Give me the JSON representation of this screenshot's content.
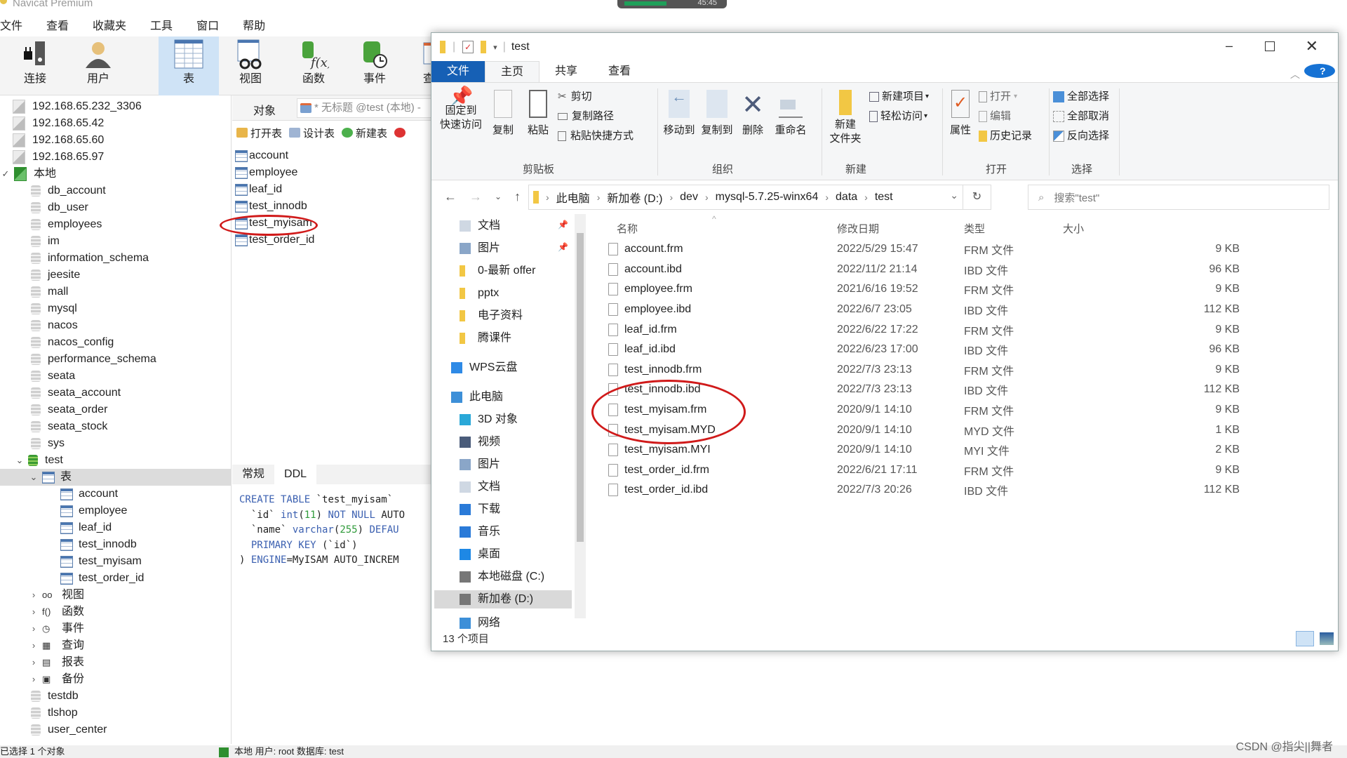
{
  "navicat": {
    "title": "Navicat Premium",
    "recording_time": "45:45",
    "menu": [
      "文件",
      "查看",
      "收藏夹",
      "工具",
      "窗口",
      "帮助"
    ],
    "toolbar": [
      {
        "label": "连接",
        "icon": "plug-server-icon"
      },
      {
        "label": "用户",
        "icon": "user-icon"
      },
      {
        "label": "表",
        "icon": "table-icon",
        "active": true
      },
      {
        "label": "视图",
        "icon": "view-glasses-icon"
      },
      {
        "label": "函数",
        "icon": "function-icon"
      },
      {
        "label": "事件",
        "icon": "event-clock-icon"
      },
      {
        "label": "查",
        "icon": "query-icon"
      }
    ],
    "tree": {
      "connections": [
        "192.168.65.232_3306",
        "192.168.65.42",
        "192.168.65.60",
        "192.168.65.97"
      ],
      "local_label": "本地",
      "databases_before": [
        "db_account",
        "db_user",
        "employees",
        "im",
        "information_schema",
        "jeesite",
        "mall",
        "mysql",
        "nacos",
        "nacos_config",
        "performance_schema",
        "seata",
        "seata_account",
        "seata_order",
        "seata_stock",
        "sys"
      ],
      "open_db": "test",
      "tables_node": "表",
      "tables": [
        "account",
        "employee",
        "leaf_id",
        "test_innodb",
        "test_myisam",
        "test_order_id"
      ],
      "other_nodes": [
        "视图",
        "函数",
        "事件",
        "查询",
        "报表",
        "备份"
      ],
      "databases_after": [
        "testdb",
        "tlshop",
        "user_center"
      ]
    },
    "object_tab": "对象",
    "query_tab": "* 无标题 @test (本地) -",
    "object_tools": [
      "打开表",
      "设计表",
      "新建表"
    ],
    "object_list": [
      "account",
      "employee",
      "leaf_id",
      "test_innodb",
      "test_myisam",
      "test_order_id"
    ],
    "highlighted_object": "test_myisam",
    "info_tabs": [
      "常规",
      "DDL"
    ],
    "ddl_lines": [
      "CREATE TABLE `test_myisam`",
      "  `id` int(11) NOT NULL AUTO",
      "  `name` varchar(255) DEFAU",
      "  PRIMARY KEY (`id`)",
      ") ENGINE=MyISAM AUTO_INCREM"
    ],
    "status_left": "已选择 1 个对象",
    "status_conn": "本地   用户: root   数据库: test"
  },
  "explorer": {
    "title": "test",
    "tabs": [
      "文件",
      "主页",
      "共享",
      "查看"
    ],
    "ribbon": {
      "clipboard": {
        "group": "剪贴板",
        "pin": "固定到\n快速访问",
        "copy": "复制",
        "paste": "粘贴",
        "cut": "剪切",
        "copy_path": "复制路径",
        "paste_shortcut": "粘贴快捷方式"
      },
      "organize": {
        "group": "组织",
        "move_to": "移动到",
        "copy_to": "复制到",
        "delete": "删除",
        "rename": "重命名"
      },
      "new": {
        "group": "新建",
        "new_folder": "新建\n文件夹",
        "new_item": "新建项目",
        "easy_access": "轻松访问"
      },
      "open": {
        "group": "打开",
        "properties": "属性",
        "open": "打开",
        "edit": "编辑",
        "history": "历史记录"
      },
      "select": {
        "group": "选择",
        "select_all": "全部选择",
        "select_none": "全部取消",
        "invert": "反向选择"
      }
    },
    "breadcrumb": [
      "此电脑",
      "新加卷 (D:)",
      "dev",
      "mysql-5.7.25-winx64",
      "data",
      "test"
    ],
    "search_placeholder": "搜索\"test\"",
    "nav_pane": [
      {
        "label": "文档",
        "icon": "document-icon",
        "pinned": true
      },
      {
        "label": "图片",
        "icon": "picture-icon",
        "pinned": true
      },
      {
        "label": "0-最新 offer",
        "icon": "folder-icon"
      },
      {
        "label": "pptx",
        "icon": "folder-icon"
      },
      {
        "label": "电子资料",
        "icon": "folder-icon"
      },
      {
        "label": "腾课件",
        "icon": "folder-icon"
      },
      {
        "label": "WPS云盘",
        "icon": "cloud-icon"
      },
      {
        "label": "此电脑",
        "icon": "computer-icon"
      },
      {
        "label": "3D 对象",
        "icon": "cube-icon"
      },
      {
        "label": "视频",
        "icon": "video-icon"
      },
      {
        "label": "图片",
        "icon": "picture-icon"
      },
      {
        "label": "文档",
        "icon": "document-icon"
      },
      {
        "label": "下载",
        "icon": "download-icon"
      },
      {
        "label": "音乐",
        "icon": "music-icon"
      },
      {
        "label": "桌面",
        "icon": "desktop-icon"
      },
      {
        "label": "本地磁盘 (C:)",
        "icon": "drive-icon"
      },
      {
        "label": "新加卷 (D:)",
        "icon": "drive-icon",
        "selected": true
      },
      {
        "label": "网络",
        "icon": "network-icon"
      }
    ],
    "columns": [
      "名称",
      "修改日期",
      "类型",
      "大小"
    ],
    "files": [
      {
        "name": "account.frm",
        "date": "2022/5/29 15:47",
        "type": "FRM 文件",
        "size": "9 KB"
      },
      {
        "name": "account.ibd",
        "date": "2022/11/2 21:14",
        "type": "IBD 文件",
        "size": "96 KB"
      },
      {
        "name": "employee.frm",
        "date": "2021/6/16 19:52",
        "type": "FRM 文件",
        "size": "9 KB"
      },
      {
        "name": "employee.ibd",
        "date": "2022/6/7 23:05",
        "type": "IBD 文件",
        "size": "112 KB"
      },
      {
        "name": "leaf_id.frm",
        "date": "2022/6/22 17:22",
        "type": "FRM 文件",
        "size": "9 KB"
      },
      {
        "name": "leaf_id.ibd",
        "date": "2022/6/23 17:00",
        "type": "IBD 文件",
        "size": "96 KB"
      },
      {
        "name": "test_innodb.frm",
        "date": "2022/7/3 23:13",
        "type": "FRM 文件",
        "size": "9 KB"
      },
      {
        "name": "test_innodb.ibd",
        "date": "2022/7/3 23:13",
        "type": "IBD 文件",
        "size": "112 KB"
      },
      {
        "name": "test_myisam.frm",
        "date": "2020/9/1 14:10",
        "type": "FRM 文件",
        "size": "9 KB"
      },
      {
        "name": "test_myisam.MYD",
        "date": "2020/9/1 14:10",
        "type": "MYD 文件",
        "size": "1 KB"
      },
      {
        "name": "test_myisam.MYI",
        "date": "2020/9/1 14:10",
        "type": "MYI 文件",
        "size": "2 KB"
      },
      {
        "name": "test_order_id.frm",
        "date": "2022/6/21 17:11",
        "type": "FRM 文件",
        "size": "9 KB"
      },
      {
        "name": "test_order_id.ibd",
        "date": "2022/7/3 20:26",
        "type": "IBD 文件",
        "size": "112 KB"
      }
    ],
    "item_count": "13 个项目"
  },
  "watermark": "CSDN @指尖||舞者",
  "colors": {
    "accent": "#1660b5",
    "annotation": "#d01a1a",
    "selected_tool": "#cfe3f6"
  }
}
